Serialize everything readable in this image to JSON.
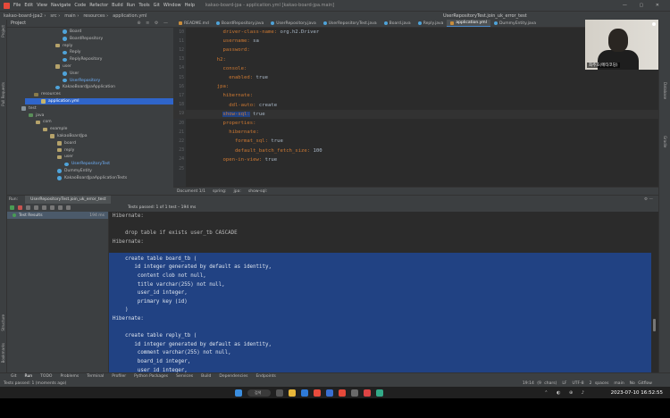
{
  "window": {
    "title": "kakao-board-jpa - application.yml [kakao-board-jpa.main]",
    "menu": [
      "File",
      "Edit",
      "View",
      "Navigate",
      "Code",
      "Refactor",
      "Build",
      "Run",
      "Tools",
      "Git",
      "Window",
      "Help"
    ],
    "breadcrumbs": [
      "kakao-board-jpa2",
      "src",
      "main",
      "resources",
      "application.yml"
    ],
    "run_config": "UserRepositoryTest.join_uk_error_test",
    "controls": "— ▢ ✕"
  },
  "project_panel": {
    "title": "Project",
    "tree": [
      {
        "label": "Board",
        "icon": "cls",
        "indent": 70
      },
      {
        "label": "BoardRepository",
        "icon": "cls",
        "indent": 70
      },
      {
        "label": "reply",
        "icon": "pkg",
        "indent": 62
      },
      {
        "label": "Reply",
        "icon": "cls",
        "indent": 70
      },
      {
        "label": "ReplyRepository",
        "icon": "cls",
        "indent": 70
      },
      {
        "label": "user",
        "icon": "pkg",
        "indent": 62
      },
      {
        "label": "User",
        "icon": "cls",
        "indent": 70
      },
      {
        "label": "UserRepository",
        "icon": "cls",
        "indent": 70,
        "highlight": true
      },
      {
        "label": "KakaoBoardJpaApplication",
        "icon": "cls",
        "indent": 62
      },
      {
        "label": "resources",
        "icon": "rfolder",
        "indent": 38
      },
      {
        "label": "application.yml",
        "icon": "file",
        "indent": 46,
        "selected": true
      },
      {
        "label": "test",
        "icon": "folder",
        "indent": 24
      },
      {
        "label": "java",
        "icon": "tfolder",
        "indent": 32
      },
      {
        "label": "com",
        "icon": "pkg",
        "indent": 40
      },
      {
        "label": "example",
        "icon": "pkg",
        "indent": 48
      },
      {
        "label": "kakaoBoardJpa",
        "icon": "pkg",
        "indent": 56
      },
      {
        "label": "board",
        "icon": "pkg",
        "indent": 64
      },
      {
        "label": "reply",
        "icon": "pkg",
        "indent": 64
      },
      {
        "label": "user",
        "icon": "pkg",
        "indent": 64
      },
      {
        "label": "UserRepositoryTest",
        "icon": "cls",
        "indent": 72,
        "highlight": true
      },
      {
        "label": "DummyEntity",
        "icon": "cls",
        "indent": 64
      },
      {
        "label": "KakaoBoardJpaApplicationTests",
        "icon": "cls",
        "indent": 64
      }
    ]
  },
  "editor": {
    "tabs": [
      {
        "label": "README.md",
        "type": "md"
      },
      {
        "label": "BoardRepository.java",
        "type": "java"
      },
      {
        "label": "UserRepository.java",
        "type": "java"
      },
      {
        "label": "UserRepositoryTest.java",
        "type": "java"
      },
      {
        "label": "Board.java",
        "type": "java"
      },
      {
        "label": "Reply.java",
        "type": "java"
      },
      {
        "label": "application.yml",
        "type": "yml",
        "active": true
      },
      {
        "label": "DummyEntity.java",
        "type": "java"
      }
    ],
    "lines": [
      {
        "n": "10",
        "key": "    driver-class-name: ",
        "val": "org.h2.Driver"
      },
      {
        "n": "11",
        "key": "    username: ",
        "val": "sa"
      },
      {
        "n": "12",
        "key": "    password:",
        "val": ""
      },
      {
        "n": "13",
        "key": "  h2:",
        "val": ""
      },
      {
        "n": "14",
        "key": "    console:",
        "val": ""
      },
      {
        "n": "15",
        "key": "      enabled: ",
        "val": "true"
      },
      {
        "n": "16",
        "key": "  jpa:",
        "val": ""
      },
      {
        "n": "17",
        "key": "    hibernate:",
        "val": ""
      },
      {
        "n": "18",
        "key": "      ddl-auto: ",
        "val": "create"
      },
      {
        "n": "19",
        "key": "    show-sql: ",
        "val": "true",
        "current": true,
        "selected_key": true
      },
      {
        "n": "20",
        "key": "    properties:",
        "val": ""
      },
      {
        "n": "21",
        "key": "      hibernate:",
        "val": ""
      },
      {
        "n": "22",
        "key": "        format_sql: ",
        "val": "true"
      },
      {
        "n": "23",
        "key": "        default_batch_fetch_size: ",
        "val": "100"
      },
      {
        "n": "24",
        "key": "    open-in-view: ",
        "val": "true"
      },
      {
        "n": "25",
        "key": "",
        "val": ""
      }
    ],
    "status_path": [
      "Document 1/1",
      "spring:",
      "jpa:",
      "show-sql:"
    ]
  },
  "run_panel": {
    "label": "Run:",
    "tab": "UserRepositoryTest.join_uk_error_test",
    "passed": "Tests passed: 1 of 1 test – 194 ms",
    "test_root": "Test Results",
    "test_time": "194 ms",
    "console": [
      {
        "t": "Hibernate:",
        "sel": false
      },
      {
        "t": "",
        "sel": false
      },
      {
        "t": "    drop table if exists user_tb CASCADE",
        "sel": false
      },
      {
        "t": "Hibernate:",
        "sel": false
      },
      {
        "t": "",
        "sel": false
      },
      {
        "t": "    create table board_tb (",
        "sel": true
      },
      {
        "t": "       id integer generated by default as identity,",
        "sel": true
      },
      {
        "t": "        content clob not null,",
        "sel": true
      },
      {
        "t": "        title varchar(255) not null,",
        "sel": true
      },
      {
        "t": "        user_id integer,",
        "sel": true
      },
      {
        "t": "        primary key (id)",
        "sel": true
      },
      {
        "t": "    )",
        "sel": true
      },
      {
        "t": "Hibernate:",
        "sel": true
      },
      {
        "t": "",
        "sel": true
      },
      {
        "t": "    create table reply_tb (",
        "sel": true
      },
      {
        "t": "       id integer generated by default as identity,",
        "sel": true
      },
      {
        "t": "        comment varchar(255) not null,",
        "sel": true
      },
      {
        "t": "        board_id integer,",
        "sel": true
      },
      {
        "t": "        user_id integer,",
        "sel": true
      }
    ]
  },
  "toolwindows": [
    "Git",
    "Run",
    "TODO",
    "Problems",
    "Terminal",
    "Profiler",
    "Python Packages",
    "Services",
    "Build",
    "Dependencies",
    "Endpoints"
  ],
  "left_strip": [
    "Project",
    "Pull Requests",
    "Structure",
    "Bookmarks"
  ],
  "right_strip": [
    "Database",
    "Gradle"
  ],
  "status": {
    "message": "Tests passed: 1 (moments ago)",
    "right": [
      "19:14 (9 chars)",
      "LF",
      "UTF-8",
      "2 spaces",
      "main",
      "No Gitflow"
    ]
  },
  "taskbar": {
    "search": "검색",
    "clock": "2023-07-10  16:52:55"
  },
  "webcam": {
    "name": "최주호(메타코딩)"
  }
}
